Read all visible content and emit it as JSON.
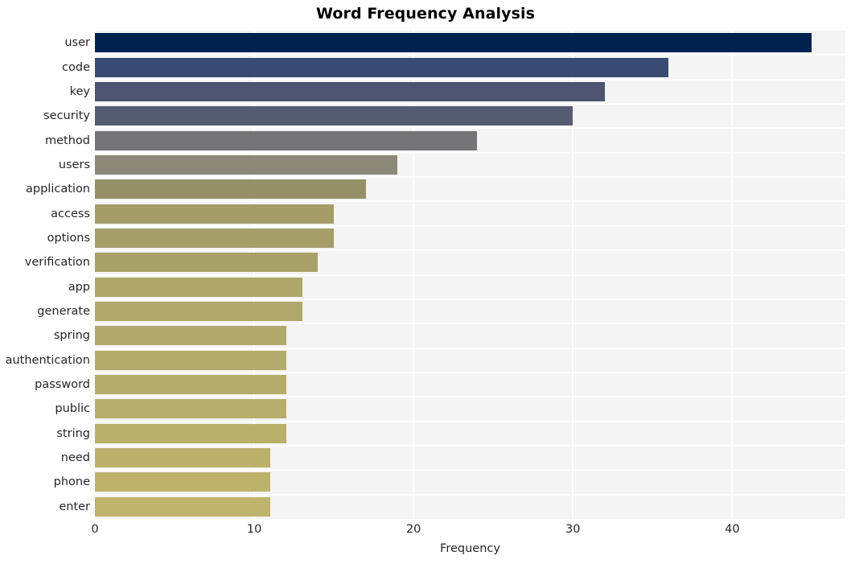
{
  "chart_data": {
    "type": "bar",
    "orientation": "horizontal",
    "title": "Word Frequency Analysis",
    "xlabel": "Frequency",
    "ylabel": "",
    "categories": [
      "user",
      "code",
      "key",
      "security",
      "method",
      "users",
      "application",
      "access",
      "options",
      "verification",
      "app",
      "generate",
      "spring",
      "authentication",
      "password",
      "public",
      "string",
      "need",
      "phone",
      "enter"
    ],
    "values": [
      45,
      36,
      32,
      30,
      24,
      19,
      17,
      15,
      15,
      14,
      13,
      13,
      12,
      12,
      12,
      12,
      12,
      11,
      11,
      11
    ],
    "bar_colors": [
      "#00214e",
      "#394b73",
      "#4d5470",
      "#555b72",
      "#757578",
      "#8c8877",
      "#969069",
      "#a49d6a",
      "#a59e6a",
      "#a9a16a",
      "#aea66a",
      "#afa76b",
      "#b1a96b",
      "#b3ab6b",
      "#b5ac6b",
      "#b7ae6b",
      "#b8af6b",
      "#bcb16c",
      "#bdb26c",
      "#beb36c"
    ],
    "xticks": [
      0,
      10,
      20,
      30,
      40
    ],
    "xtick_labels": [
      "0",
      "10",
      "20",
      "30",
      "40"
    ],
    "xlim": [
      0,
      47.1
    ],
    "grid": true,
    "grid_color": "#ffffff",
    "plot_background": "#f4f4f5",
    "figure_background": "#ffffff",
    "legend": null
  }
}
